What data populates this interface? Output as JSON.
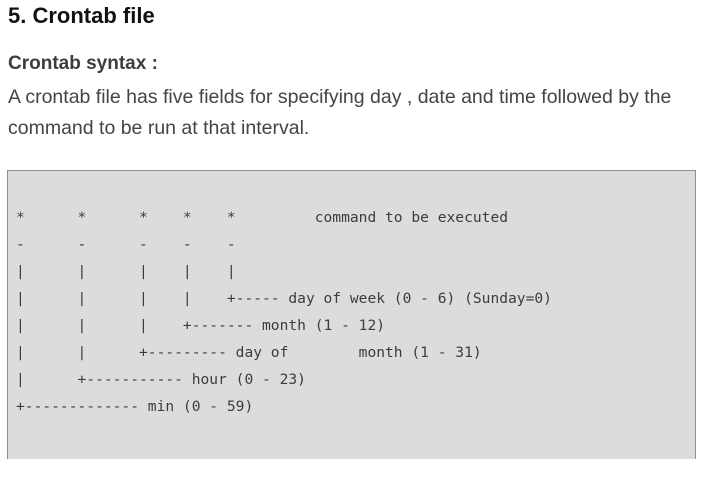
{
  "section": {
    "title": "5. Crontab file",
    "subtitle": "Crontab syntax :",
    "description": "A crontab file has five fields for specifying day , date and time followed by the command to be run at that interval."
  },
  "code": {
    "lines": [
      "*      *      *    *    *         command to be executed",
      "-      -      -    -    -",
      "|      |      |    |    |",
      "|      |      |    |    +----- day of week (0 - 6) (Sunday=0)",
      "|      |      |    +------- month (1 - 12)",
      "|      |      +--------- day of        month (1 - 31)",
      "|      +----------- hour (0 - 23)",
      "+------------- min (0 - 59)"
    ]
  }
}
